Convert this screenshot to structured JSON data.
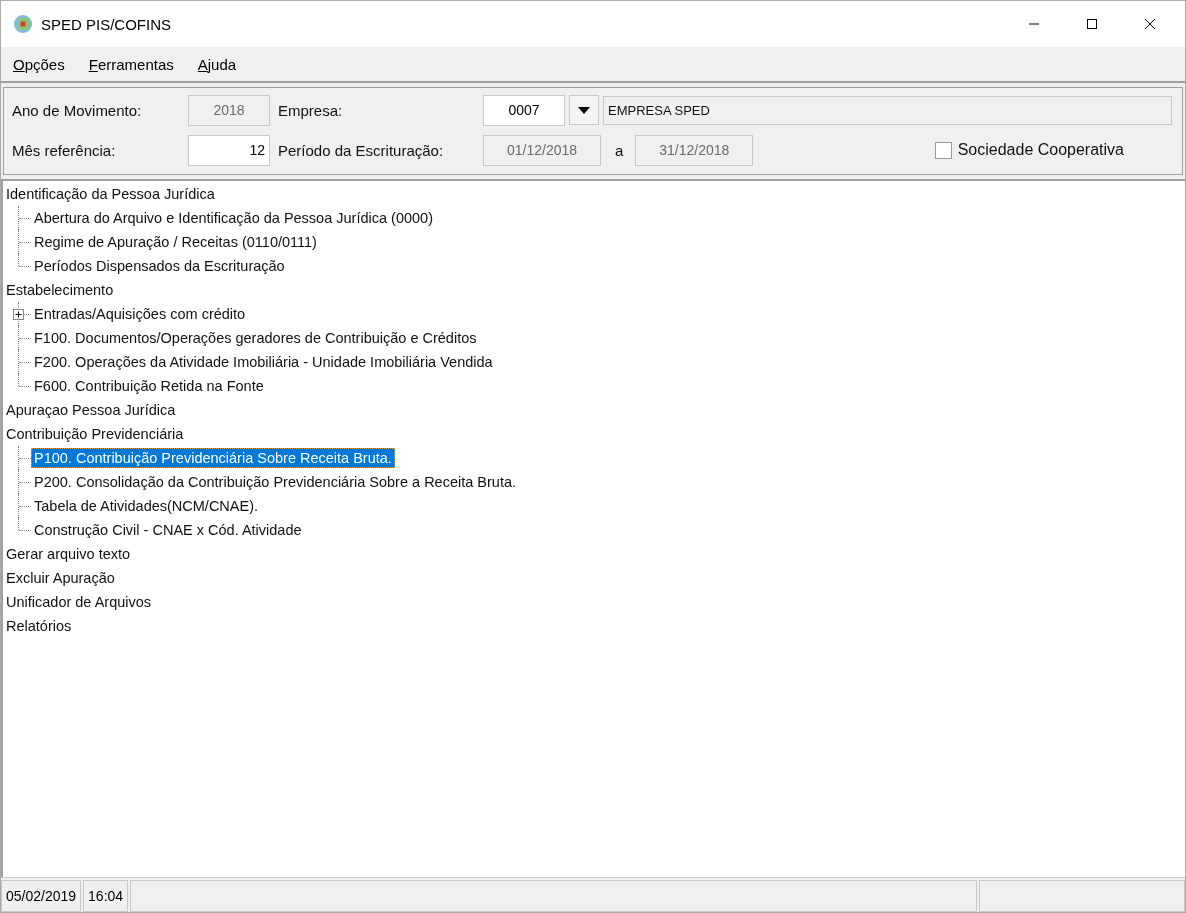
{
  "window": {
    "title": "SPED PIS/COFINS"
  },
  "menu": [
    {
      "label": "Opções"
    },
    {
      "label": "Ferramentas"
    },
    {
      "label": "Ajuda"
    }
  ],
  "form": {
    "ano_label": "Ano de Movimento:",
    "ano": {
      "value": "2018",
      "disabled": true
    },
    "empresa_label": "Empresa:",
    "empresa_code": {
      "value": "0007",
      "disabled": false
    },
    "empresa_name": {
      "value": "EMPRESA SPED",
      "disabled": true
    },
    "mes_label": "Mês referência:",
    "mes": {
      "value": "12",
      "disabled": false
    },
    "periodo_label": "Período da Escrituração:",
    "periodo_start": {
      "value": "01/12/2018",
      "disabled": true
    },
    "periodo_sep": "a",
    "periodo_end": {
      "value": "31/12/2018",
      "disabled": true
    },
    "cooperativa": {
      "label": "Sociedade Cooperativa",
      "checked": false
    }
  },
  "tree": [
    {
      "label": "Identificação da Pessoa Jurídica",
      "selected": false,
      "children": [
        {
          "label": "Abertura do Arquivo e Identificação da Pessoa Jurídica (0000)",
          "selected": false
        },
        {
          "label": "Regime de Apuração / Receitas (0110/0111)",
          "selected": false
        },
        {
          "label": "Períodos Dispensados da Escrituração",
          "selected": false
        }
      ]
    },
    {
      "label": "Estabelecimento",
      "selected": false,
      "children": [
        {
          "label": "Entradas/Aquisições com crédito",
          "selected": false,
          "expanded": false
        },
        {
          "label": "F100. Documentos/Operações geradores de Contribuição e Créditos",
          "selected": false
        },
        {
          "label": "F200. Operações da Atividade Imobiliária - Unidade Imobiliária Vendida",
          "selected": false
        },
        {
          "label": "F600. Contribuição Retida na Fonte",
          "selected": false
        }
      ]
    },
    {
      "label": "Apuraçao Pessoa Jurídica",
      "selected": false
    },
    {
      "label": "Contribuição Previdenciária",
      "selected": false,
      "children": [
        {
          "label": "P100. Contribuição Previdenciária Sobre Receita Bruta.",
          "selected": true
        },
        {
          "label": "P200. Consolidação da Contribuição Previdenciária Sobre a Receita Bruta.",
          "selected": false
        },
        {
          "label": "Tabela de Atividades(NCM/CNAE).",
          "selected": false
        },
        {
          "label": "Construção Civil - CNAE x Cód. Atividade",
          "selected": false
        }
      ]
    },
    {
      "label": "Gerar arquivo texto",
      "selected": false
    },
    {
      "label": "Excluir Apuração",
      "selected": false
    },
    {
      "label": "Unificador de Arquivos",
      "selected": false
    },
    {
      "label": "Relatórios",
      "selected": false
    }
  ],
  "status_bar": {
    "date": "05/02/2019",
    "time": "16:04"
  }
}
